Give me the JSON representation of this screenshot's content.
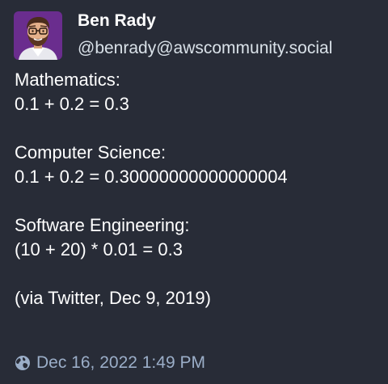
{
  "author": {
    "display_name": "Ben Rady",
    "handle": "@benrady@awscommunity.social",
    "avatar_icon": "bearded-man-avatar"
  },
  "content": {
    "paragraphs": [
      {
        "lines": [
          "Mathematics:",
          "0.1 + 0.2 = 0.3"
        ]
      },
      {
        "lines": [
          "Computer Science:",
          "0.1 + 0.2 = 0.30000000000000004"
        ]
      },
      {
        "lines": [
          "Software Engineering:",
          "(10 + 20) * 0.01 = 0.3"
        ]
      },
      {
        "lines": [
          "(via Twitter, Dec 9, 2019)"
        ]
      }
    ]
  },
  "meta": {
    "visibility_icon": "globe-icon",
    "timestamp": "Dec 16, 2022 1:49 PM"
  },
  "colors": {
    "background": "#282c37",
    "text": "#ffffff",
    "handle": "#d9e1e8",
    "meta": "#9baec8",
    "avatar_bg": "#6a2d8e"
  }
}
